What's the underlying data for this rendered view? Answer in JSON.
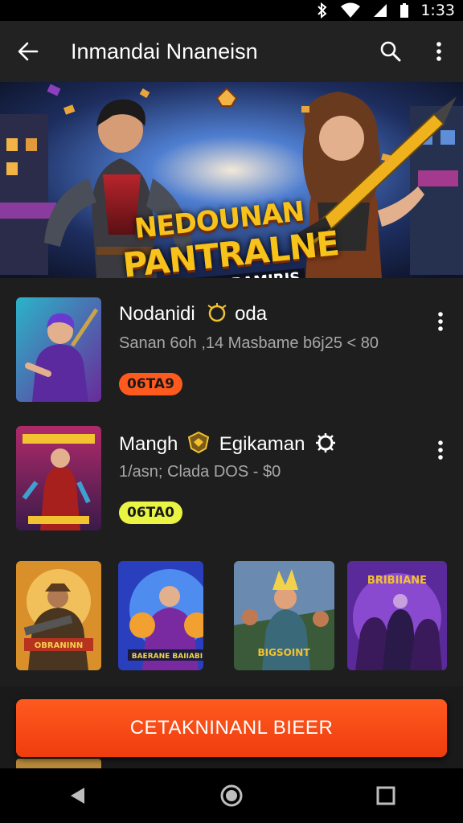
{
  "status_bar": {
    "time": "1:33"
  },
  "app_bar": {
    "title": "Inmandai Nnaneisn"
  },
  "banner": {
    "title_line1": "NEDOUNAN",
    "title_line2": "PANTRALNE",
    "subtitle": "SEHNOH BAMIRIS"
  },
  "list": [
    {
      "title": "Nodanidi",
      "title_tail": "oda",
      "subtitle": "Sanan 6oh ,14 Masbame b6j25 < 80",
      "badge": "06TA9",
      "badge_color": "#ff5a1e",
      "badge_text_color": "#1a1a1a"
    },
    {
      "title": "Mangh",
      "title_tail": "Egikaman",
      "subtitle": "1/asn; Clada DOS - $0",
      "badge": "06TA0",
      "badge_color": "#e9f542",
      "badge_text_color": "#1a1a1a"
    }
  ],
  "grid": [
    {
      "label": "OBRANINN"
    },
    {
      "label": "BAERANE BAIIABIE"
    },
    {
      "label": "BIGSOINT"
    },
    {
      "label": "BRIBIIANE"
    }
  ],
  "cta": {
    "label": "CETAKNINANL BIEER"
  },
  "colors": {
    "accent": "#ff5a1e",
    "background": "#1e1e1e",
    "app_bar": "#222222"
  }
}
